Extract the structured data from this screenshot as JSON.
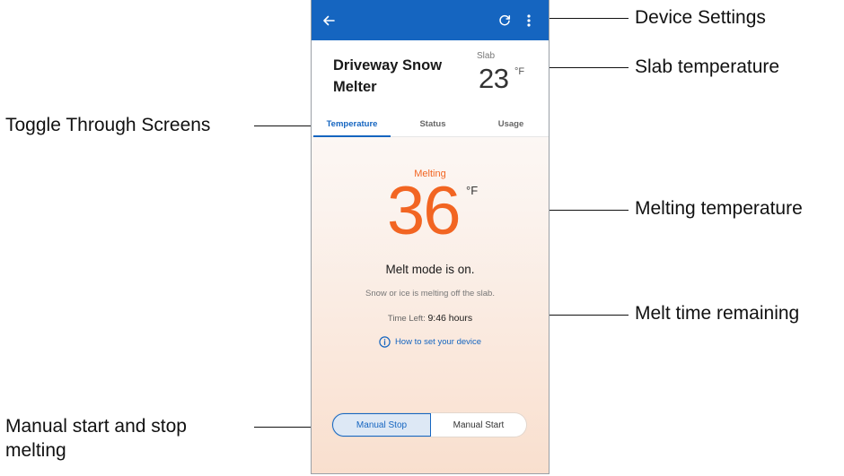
{
  "app": {
    "device_name": "Driveway Snow Melter",
    "slab": {
      "label": "Slab",
      "value": "23",
      "unit": "°F"
    },
    "tabs": [
      {
        "label": "Temperature",
        "active": true
      },
      {
        "label": "Status",
        "active": false
      },
      {
        "label": "Usage",
        "active": false
      }
    ],
    "melting": {
      "status_label": "Melting",
      "temperature": "36",
      "unit": "°F",
      "mode_title": "Melt mode is on.",
      "mode_desc": "Snow or ice is melting off the slab.",
      "time_left_label": "Time Left:",
      "time_left_value": "9:46 hours"
    },
    "help_link": "How to set your device",
    "control": {
      "stop_label": "Manual Stop",
      "start_label": "Manual Start",
      "selected": "Manual Stop"
    },
    "icons": {
      "back": "arrow-left-icon",
      "refresh": "refresh-icon",
      "menu": "more-vertical-icon",
      "info": "info-icon"
    },
    "colors": {
      "appbar": "#1565c0",
      "accent": "#f26522",
      "link": "#1565c0"
    }
  },
  "annotations": {
    "device_settings": "Device Settings",
    "slab_temperature": "Slab temperature",
    "toggle_screens": "Toggle Through Screens",
    "melting_temperature": "Melting temperature",
    "melt_time": "Melt time remaining",
    "manual_line1": "Manual start and stop",
    "manual_line2": "melting"
  }
}
